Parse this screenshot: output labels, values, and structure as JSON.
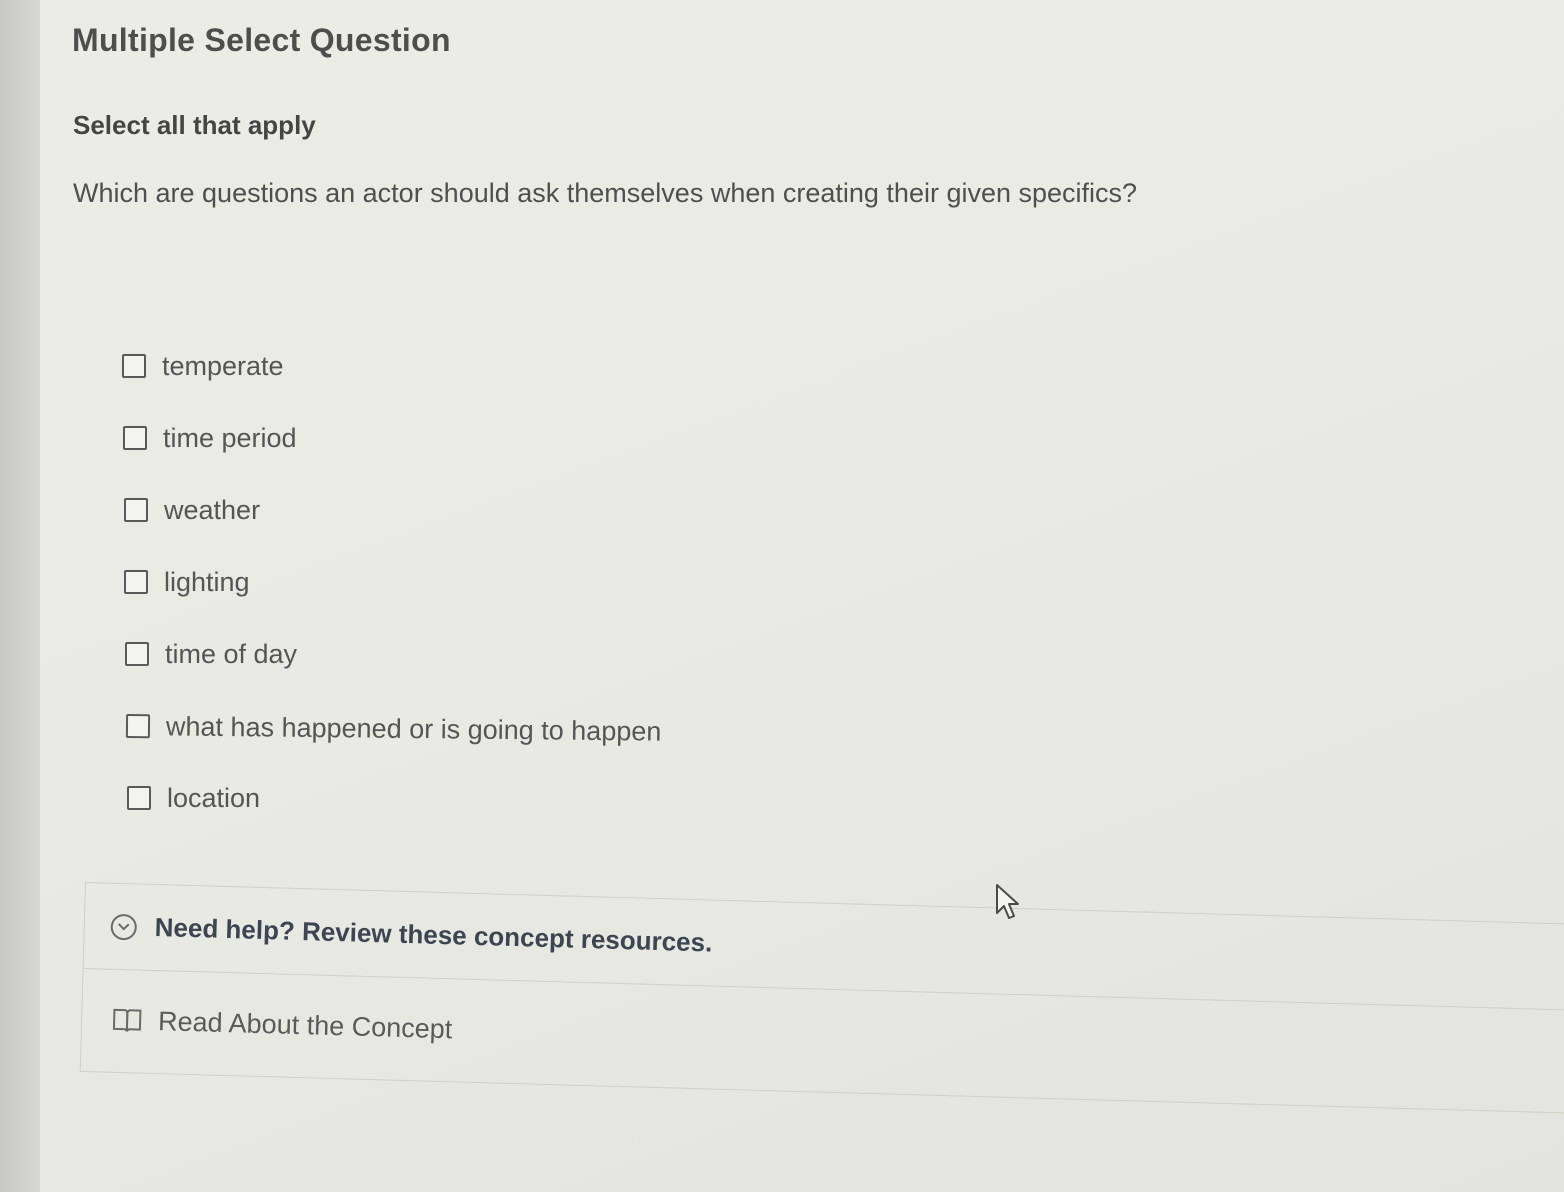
{
  "question": {
    "type_label": "Multiple Select Question",
    "instruction": "Select all that apply",
    "prompt": "Which are questions an actor should ask themselves when creating their given specifics?"
  },
  "options": [
    {
      "label": "temperate",
      "checked": false
    },
    {
      "label": "time period",
      "checked": false
    },
    {
      "label": "weather",
      "checked": false
    },
    {
      "label": "lighting",
      "checked": false
    },
    {
      "label": "time of day",
      "checked": false
    },
    {
      "label": "what has happened or is going to happen",
      "checked": false
    },
    {
      "label": "location",
      "checked": false
    }
  ],
  "help": {
    "title": "Need help? Review these concept resources.",
    "icon": "chevron-down-circle-icon",
    "resources": [
      {
        "label": "Read About the Concept",
        "icon": "book-icon"
      }
    ]
  },
  "colors": {
    "background": "#eaeae5",
    "text": "#4f4f4f",
    "help_title": "#3d4650"
  }
}
